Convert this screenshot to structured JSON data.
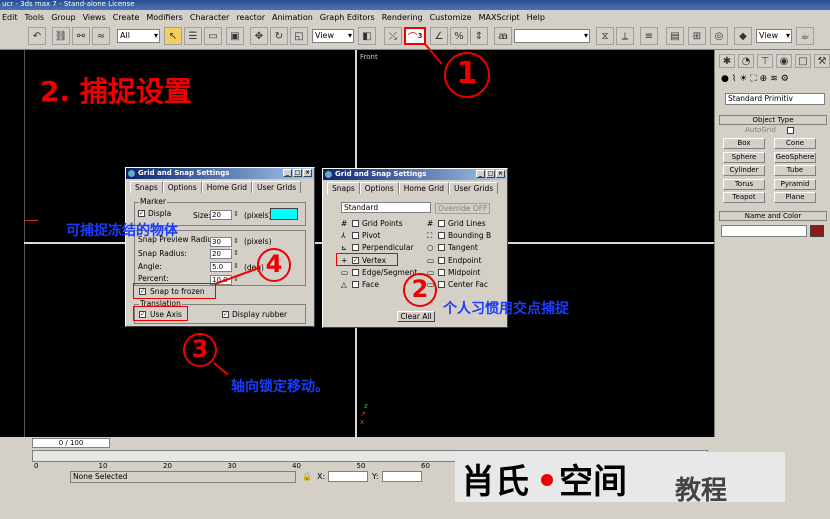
{
  "window": {
    "title": "ucr - 3ds max 7 - Stand-alone License"
  },
  "menu": [
    "Edit",
    "Tools",
    "Group",
    "Views",
    "Create",
    "Modifiers",
    "Character",
    "reactor",
    "Animation",
    "Graph Editors",
    "Rendering",
    "Customize",
    "MAXScript",
    "Help"
  ],
  "toolbar": {
    "filter_value": "All",
    "refcoord_value": "View",
    "snap_toggle_label": "3",
    "named_sel_value": "",
    "view_label2": "View"
  },
  "viewports": {
    "front_label": "Front"
  },
  "heading": "2. 捕捉设置",
  "command_panel": {
    "dropdown_value": "Standard Primitiv",
    "object_type_title": "Object Type",
    "autogrid_label": "AutoGrid",
    "buttons": [
      "Box",
      "Cone",
      "Sphere",
      "GeoSphere",
      "Cylinder",
      "Tube",
      "Torus",
      "Pyramid",
      "Teapot",
      "Plane"
    ],
    "name_color_title": "Name and Color"
  },
  "dialog_left": {
    "title": "Grid and Snap Settings",
    "tabs": [
      "Snaps",
      "Options",
      "Home Grid",
      "User Grids"
    ],
    "marker_group": "Marker",
    "display_label": "Displa",
    "size_label": "Size:",
    "size_value": "20",
    "pixels_label": "(pixels)",
    "marker_color": "#00ffff",
    "preview_label": "Snap Preview Radius:",
    "preview_value": "30",
    "radius_label": "Snap Radius:",
    "radius_value": "20",
    "angle_label": "Angle:",
    "angle_value": "5.0",
    "deg_label": "(deg)",
    "percent_label": "Percent:",
    "percent_value": "10.0",
    "snap_frozen_label": "Snap to frozen",
    "translation_group": "Translation",
    "use_axis_label": "Use Axis",
    "display_rubber_label": "Display rubber"
  },
  "dialog_right": {
    "title": "Grid and Snap Settings",
    "tabs": [
      "Snaps",
      "Options",
      "Home Grid",
      "User Grids"
    ],
    "standard_value": "Standard",
    "override_label": "Override OFF",
    "snaps_left": [
      "Grid Points",
      "Pivot",
      "Perpendicular",
      "Vertex",
      "Edge/Segment",
      "Face"
    ],
    "snaps_right": [
      "Grid Lines",
      "Bounding B",
      "Tangent",
      "Endpoint",
      "Midpoint",
      "Center Fac"
    ],
    "clear_all_label": "Clear All"
  },
  "annotations": {
    "num1": "1",
    "num2": "2",
    "num3": "3",
    "num4": "4",
    "frozen_note": "可捕捉冻结的物体",
    "vertex_note": "个人习惯用交点捕捉",
    "axis_note": "轴向锁定移动。"
  },
  "timeline": {
    "frame_label": "0 / 100",
    "ticks": [
      "0",
      "10",
      "20",
      "30",
      "40",
      "50",
      "60",
      "70",
      "80",
      "90",
      "100"
    ]
  },
  "status": {
    "selection": "None Selected",
    "x_label": "X:",
    "y_label": "Y:"
  },
  "brand": {
    "part1": "肖氏",
    "part2": "空间",
    "part3": "教程"
  }
}
